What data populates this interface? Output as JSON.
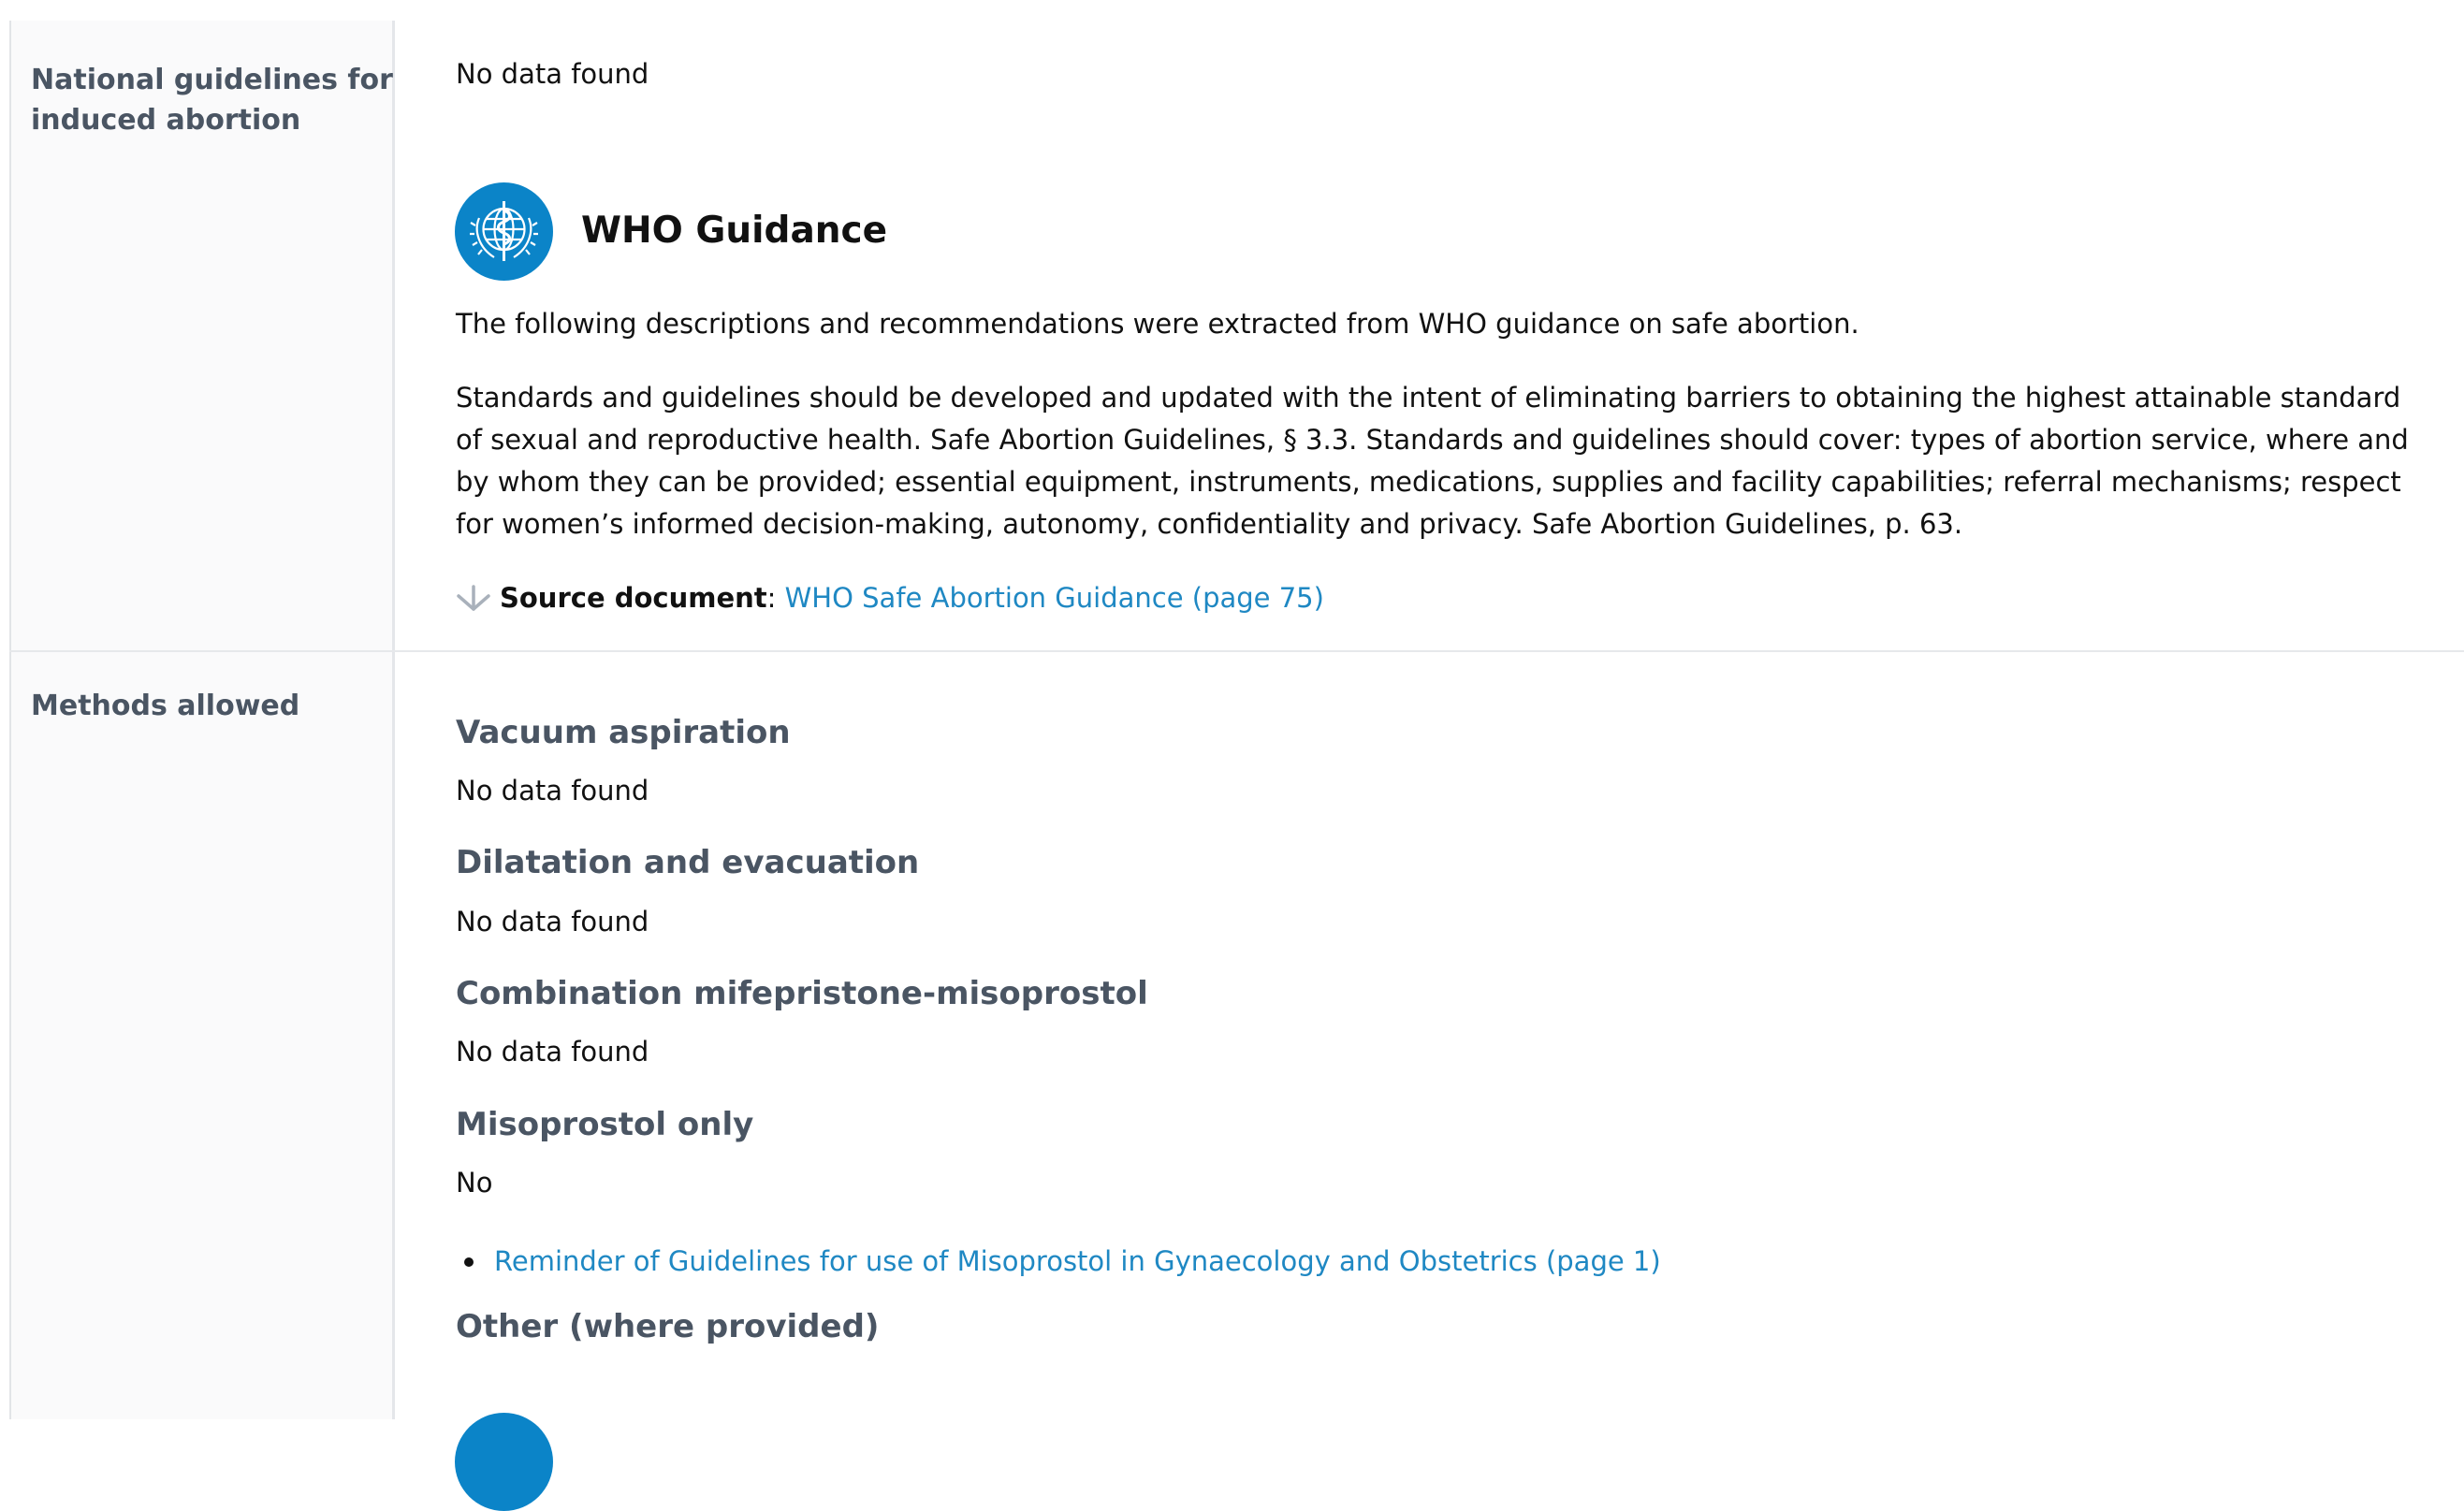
{
  "rows": {
    "national_guidelines": {
      "label": "National guidelines for induced abortion",
      "value": "No data found"
    },
    "methods": {
      "label": "Methods allowed"
    }
  },
  "who": {
    "title": "WHO Guidance",
    "intro": "The following descriptions and recommendations were extracted from WHO guidance on safe abortion.",
    "body": "Standards and guidelines should be developed and updated with the intent of eliminating barriers to obtaining the highest attainable standard of sexual and reproductive health. Safe Abortion Guidelines, § 3.3. Standards and guidelines should cover: types of abortion service, where and by whom they can be provided; essential equipment, instruments, medications, supplies and facility capabilities; referral mechanisms; respect for women’s informed decision-making, autonomy, confidentiality and privacy. Safe Abortion Guidelines, p. 63.",
    "source_label": "Source document",
    "source_sep": ":",
    "source_link": "WHO Safe Abortion Guidance (page 75)"
  },
  "methods": [
    {
      "heading": "Vacuum aspiration",
      "value": "No data found"
    },
    {
      "heading": "Dilatation and evacuation",
      "value": "No data found"
    },
    {
      "heading": "Combination mifepristone-misoprostol",
      "value": "No data found"
    },
    {
      "heading": "Misoprostol only",
      "value": "No"
    },
    {
      "heading": "Other (where provided)"
    }
  ],
  "misoprostol_link": "Reminder of Guidelines for use of Misoprostol in Gynaecology and Obstetrics (page 1)",
  "colors": {
    "link": "#1f88c3",
    "heading_gray": "#4a5563",
    "who_blue": "#0b84c8"
  },
  "icons": {
    "who": "who-emblem-icon",
    "download": "download-arrow-icon"
  }
}
